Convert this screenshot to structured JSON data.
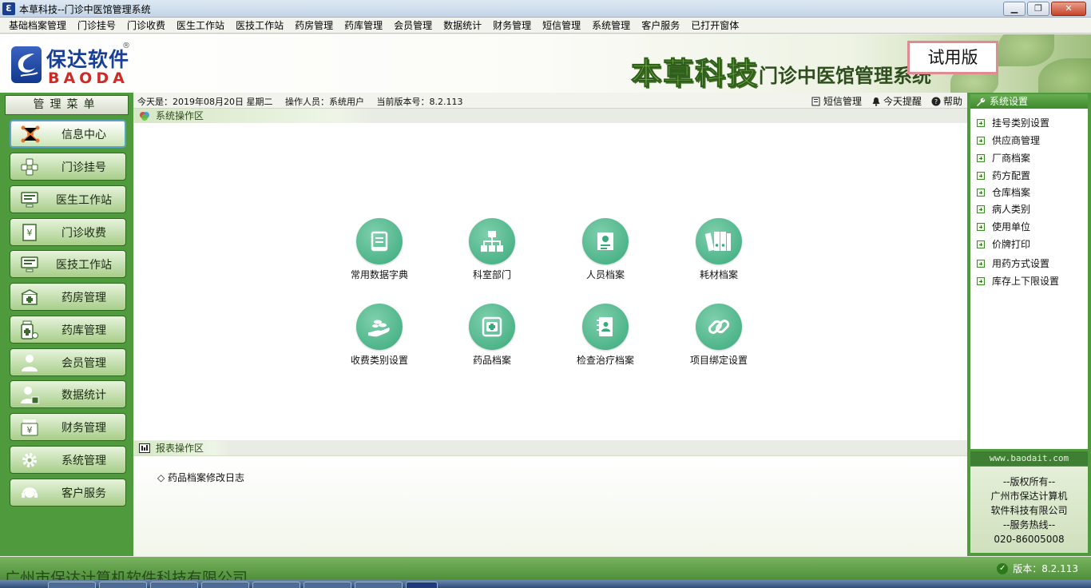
{
  "window": {
    "title": "本草科技--门诊中医馆管理系统",
    "icon": "app-logo-icon",
    "controls": [
      "minimize",
      "maximize",
      "close"
    ]
  },
  "menu": [
    "基础档案管理",
    "门诊挂号",
    "门诊收费",
    "医生工作站",
    "医技工作站",
    "药房管理",
    "药库管理",
    "会员管理",
    "数据统计",
    "财务管理",
    "短信管理",
    "系统管理",
    "客户服务",
    "已打开窗体"
  ],
  "banner": {
    "logo_cn": "保达软件",
    "logo_en": "BAODA",
    "logo_reg": "®",
    "brand": "本草科技",
    "system_name": "门诊中医馆管理系统",
    "trial_badge": "试用版"
  },
  "left_menu": {
    "header": "管理菜单",
    "items": [
      {
        "label": "信息中心",
        "icon": "network-icon",
        "active": true
      },
      {
        "label": "门诊挂号",
        "icon": "registration-icon"
      },
      {
        "label": "医生工作站",
        "icon": "monitor-icon"
      },
      {
        "label": "门诊收费",
        "icon": "receipt-icon"
      },
      {
        "label": "医技工作站",
        "icon": "monitor-icon"
      },
      {
        "label": "药房管理",
        "icon": "pharmacy-icon"
      },
      {
        "label": "药库管理",
        "icon": "medicine-bottle-icon"
      },
      {
        "label": "会员管理",
        "icon": "member-icon"
      },
      {
        "label": "数据统计",
        "icon": "statistics-icon"
      },
      {
        "label": "财务管理",
        "icon": "finance-icon"
      },
      {
        "label": "系统管理",
        "icon": "gear-icon"
      },
      {
        "label": "客户服务",
        "icon": "headset-icon"
      }
    ]
  },
  "info_bar": {
    "date": "今天是：2019年08月20日 星期二",
    "operator": "操作人员：系统用户",
    "version": "当前版本号：8.2.113",
    "links": [
      {
        "label": "短信管理",
        "icon": "sms-icon"
      },
      {
        "label": "今天提醒",
        "icon": "bell-icon"
      },
      {
        "label": "帮助",
        "icon": "help-icon"
      }
    ]
  },
  "system_area": {
    "title": "系统操作区",
    "tiles": [
      {
        "label": "常用数据字典",
        "icon": "dictionary-icon"
      },
      {
        "label": "科室部门",
        "icon": "org-chart-icon"
      },
      {
        "label": "人员档案",
        "icon": "personnel-file-icon"
      },
      {
        "label": "耗材档案",
        "icon": "binders-icon"
      },
      {
        "label": "收费类别设置",
        "icon": "fee-category-icon"
      },
      {
        "label": "药品档案",
        "icon": "medicine-kit-icon"
      },
      {
        "label": "检查治疗档案",
        "icon": "exam-record-icon"
      },
      {
        "label": "项目绑定设置",
        "icon": "link-icon"
      }
    ]
  },
  "report_area": {
    "title": "报表操作区",
    "links": [
      "◇ 药品档案修改日志"
    ]
  },
  "right_panel": {
    "header": "系统设置",
    "items": [
      "挂号类别设置",
      "供应商管理",
      "厂商档案",
      "药方配置",
      "仓库档案",
      "病人类别",
      "使用单位",
      "价牌打印",
      "用药方式设置",
      "库存上下限设置"
    ],
    "site": "www.baodait.com",
    "company_lines": [
      "--版权所有--",
      "广州市保达计算机",
      "软件科技有限公司",
      "--服务热线--",
      "020-86005008"
    ]
  },
  "status_bar": {
    "watermark": "广州市保达计算机软件科技有限公司",
    "version": "版本：8.2.113"
  },
  "colors": {
    "sidebar_green": "#4f9a3c",
    "tile_green": "#3aa97c",
    "logo_blue": "#1a3e94",
    "logo_red": "#d02a26",
    "trial_border": "#e08a92"
  }
}
